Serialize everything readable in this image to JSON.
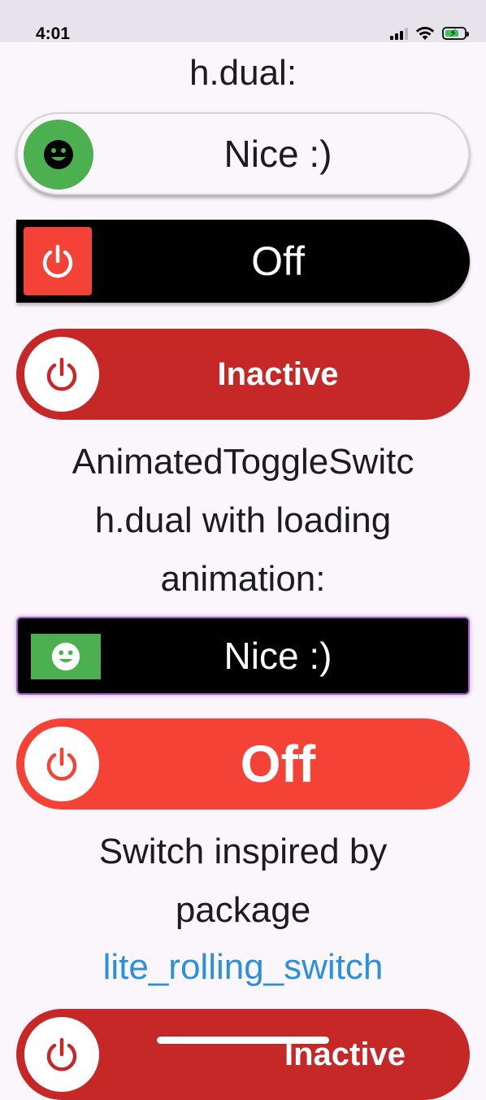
{
  "status_bar": {
    "time": "4:01",
    "icons": [
      "signal-icon",
      "wifi-icon",
      "battery-charging-icon"
    ]
  },
  "sections": {
    "title1": "h.dual:",
    "title2_line1": "AnimatedToggleSwitc",
    "title2_line2": "h.dual with loading",
    "title2_line3": "animation:",
    "title3_line1": "Switch inspired by",
    "title3_line2": "package",
    "title3_link": "lite_rolling_switch"
  },
  "switches": [
    {
      "label": "Nice :)",
      "icon": "smiley-icon"
    },
    {
      "label": "Off",
      "icon": "power-icon"
    },
    {
      "label": "Inactive",
      "icon": "power-icon"
    },
    {
      "label": "Nice :)",
      "icon": "smiley-icon"
    },
    {
      "label": "Off",
      "icon": "power-icon"
    },
    {
      "label": "Inactive",
      "icon": "power-icon"
    }
  ],
  "colors": {
    "background": "#fbf6fb",
    "green": "#4caf50",
    "red": "#f44336",
    "dark_red": "#c62828",
    "link": "#2a8fe0"
  }
}
